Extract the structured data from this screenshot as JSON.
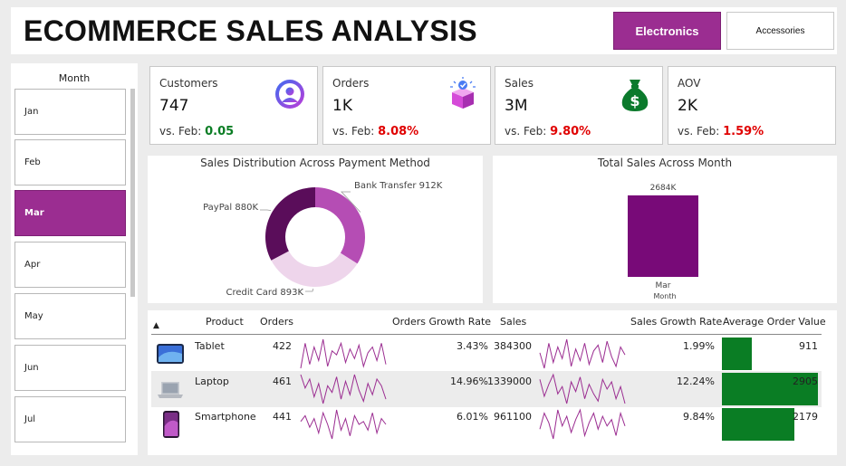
{
  "header": {
    "title": "ECOMMERCE SALES ANALYSIS",
    "categories": [
      "Electronics",
      "Accessories"
    ],
    "active_category": "Electronics"
  },
  "month_slicer": {
    "header": "Month",
    "items": [
      "Jan",
      "Feb",
      "Mar",
      "Apr",
      "May",
      "Jun",
      "Jul"
    ],
    "selected": "Mar"
  },
  "kpis": [
    {
      "label": "Customers",
      "value": "747",
      "compare_label": "vs. Feb:",
      "delta": "0.05",
      "delta_color": "#0a7d24",
      "icon": "customer-icon"
    },
    {
      "label": "Orders",
      "value": "1K",
      "compare_label": "vs. Feb:",
      "delta": "8.08%",
      "delta_color": "#e00000",
      "icon": "order-box-icon"
    },
    {
      "label": "Sales",
      "value": "3M",
      "compare_label": "vs. Feb:",
      "delta": "9.80%",
      "delta_color": "#e00000",
      "icon": "money-bag-icon"
    },
    {
      "label": "AOV",
      "value": "2K",
      "compare_label": "vs. Feb:",
      "delta": "1.59%",
      "delta_color": "#e00000",
      "icon": ""
    }
  ],
  "chart_data": [
    {
      "type": "pie",
      "title": "Sales Distribution Across Payment Method",
      "labels": [
        "Bank Transfer",
        "Credit Card",
        "PayPal"
      ],
      "values": [
        912,
        893,
        880
      ],
      "value_labels": [
        "912K",
        "893K",
        "880K"
      ],
      "colors": [
        "#b54db4",
        "#eed5eb",
        "#5a0d5a"
      ]
    },
    {
      "type": "bar",
      "title": "Total Sales Across Month",
      "categories": [
        "Mar"
      ],
      "values": [
        2684
      ],
      "value_labels": [
        "2684K"
      ],
      "xlabel": "Month",
      "ylim": [
        0,
        2800
      ],
      "color": "#780a78"
    }
  ],
  "table": {
    "columns": [
      "Product",
      "Orders",
      "Orders Growth Rate",
      "Sales",
      "Sales Growth Rate",
      "Average Order Value"
    ],
    "sort_indicator": "▲",
    "spark_color": "#9b2d91",
    "aov_color": "#0a7d24",
    "rows": [
      {
        "product": "Tablet",
        "orders": "422",
        "orders_growth": "3.43%",
        "sales": "384300",
        "sales_growth": "1.99%",
        "aov": "911",
        "aov_value": 911,
        "thumb": "tablet-icon",
        "orders_spark": [
          4,
          30,
          8,
          26,
          12,
          34,
          6,
          22,
          18,
          30,
          10,
          24,
          14,
          28,
          6,
          20,
          26,
          12,
          30,
          8
        ],
        "sales_spark": [
          20,
          4,
          30,
          10,
          26,
          14,
          34,
          6,
          24,
          12,
          30,
          8,
          22,
          28,
          10,
          32,
          16,
          6,
          26,
          18
        ]
      },
      {
        "product": "Laptop",
        "orders": "461",
        "orders_growth": "14.96%",
        "sales": "1339000",
        "sales_growth": "12.24%",
        "aov": "2905",
        "aov_value": 2905,
        "thumb": "laptop-icon",
        "orders_spark": [
          30,
          18,
          26,
          10,
          22,
          4,
          20,
          14,
          28,
          8,
          24,
          12,
          30,
          16,
          6,
          22,
          12,
          26,
          20,
          8
        ],
        "sales_spark": [
          26,
          12,
          22,
          30,
          14,
          20,
          6,
          24,
          16,
          28,
          10,
          22,
          14,
          8,
          26,
          18,
          24,
          10,
          20,
          6
        ]
      },
      {
        "product": "Smartphone",
        "orders": "441",
        "orders_growth": "6.01%",
        "sales": "961100",
        "sales_growth": "9.84%",
        "aov": "2179",
        "aov_value": 2179,
        "thumb": "smartphone-icon",
        "orders_spark": [
          20,
          24,
          16,
          22,
          12,
          26,
          18,
          8,
          28,
          14,
          22,
          10,
          24,
          18,
          20,
          14,
          26,
          12,
          22,
          18
        ],
        "sales_spark": [
          14,
          24,
          18,
          8,
          26,
          16,
          22,
          12,
          20,
          26,
          10,
          18,
          24,
          14,
          22,
          16,
          20,
          10,
          24,
          16
        ]
      }
    ]
  }
}
